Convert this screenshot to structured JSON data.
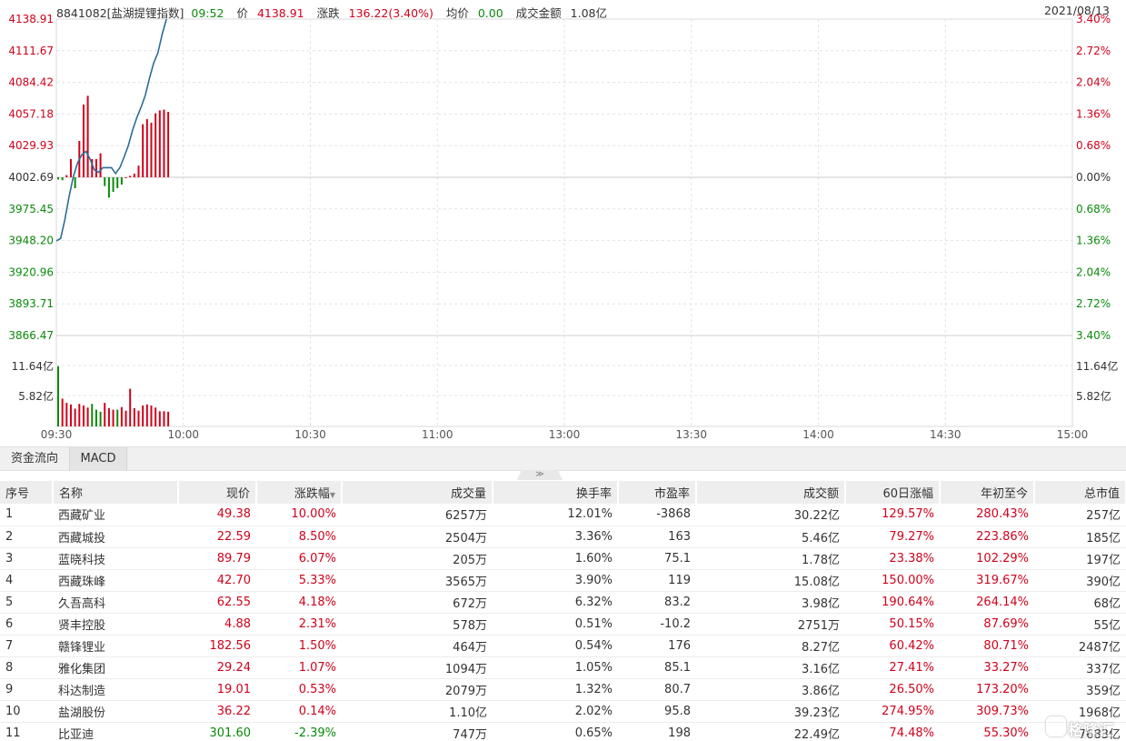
{
  "header": {
    "code_name": "8841082[盐湖提锂指数]",
    "time": "09:52",
    "price_label": "价",
    "price": "4138.91",
    "change_label": "涨跌",
    "change": "136.22(3.40%)",
    "avg_label": "均价",
    "avg": "0.00",
    "amount_label": "成交金额",
    "amount": "1.08亿",
    "date": "2021/08/13"
  },
  "colors": {
    "up": "#d0021b",
    "down": "#0b8a0b",
    "line": "#2b6d97"
  },
  "chart_data": {
    "type": "line",
    "price_ticks": [
      "4138.91",
      "4111.67",
      "4084.42",
      "4057.18",
      "4029.93",
      "4002.69",
      "3975.45",
      "3948.20",
      "3920.96",
      "3893.71",
      "3866.47"
    ],
    "percent_ticks": [
      "3.40%",
      "2.72%",
      "2.04%",
      "1.36%",
      "0.68%",
      "0.00%",
      "0.68%",
      "1.36%",
      "2.04%",
      "2.72%",
      "3.40%"
    ],
    "volume_ticks": [
      "11.64亿",
      "5.82亿"
    ],
    "time_ticks": [
      "09:30",
      "10:00",
      "10:30",
      "11:00",
      "13:00",
      "13:30",
      "14:00",
      "14:30",
      "15:00"
    ],
    "ylim": [
      3866.47,
      4138.91
    ],
    "prev_close": 4002.69,
    "minutes_total": 240,
    "price_minutes": [
      0,
      1,
      2,
      3,
      4,
      5,
      6,
      7,
      8,
      9,
      10,
      11,
      12,
      13,
      14,
      15,
      16,
      17,
      18,
      19,
      20,
      21,
      22,
      23,
      24,
      25,
      26
    ],
    "price_values": [
      3948,
      3950,
      3966,
      3986,
      4003,
      4015,
      4022,
      4025,
      4018,
      4009,
      4007,
      4011,
      4011,
      4011,
      4006,
      4011,
      4020,
      4030,
      4043,
      4054,
      4063,
      4073,
      4088,
      4101,
      4110,
      4126,
      4138.91
    ],
    "momentum_bars": [
      -3,
      -4,
      3,
      25,
      -15,
      50,
      100,
      112,
      25,
      25,
      33,
      -12,
      -28,
      -20,
      -15,
      -10,
      0,
      2,
      5,
      16,
      73,
      80,
      75,
      88,
      92,
      93,
      90
    ],
    "volume_bars": [
      [
        0,
        11.5
      ],
      [
        1,
        5.3
      ],
      [
        2,
        4.5
      ],
      [
        3,
        4.2
      ],
      [
        4,
        3.4
      ],
      [
        5,
        4.3
      ],
      [
        6,
        4.0
      ],
      [
        7,
        3.6
      ],
      [
        8,
        4.3
      ],
      [
        9,
        3.2
      ],
      [
        10,
        2.8
      ],
      [
        11,
        4.5
      ],
      [
        12,
        3.5
      ],
      [
        13,
        3.2
      ],
      [
        14,
        3.2
      ],
      [
        15,
        3.7
      ],
      [
        16,
        3.0
      ],
      [
        17,
        7.2
      ],
      [
        18,
        3.5
      ],
      [
        19,
        3.0
      ],
      [
        20,
        4.0
      ],
      [
        21,
        4.2
      ],
      [
        22,
        4.0
      ],
      [
        23,
        3.6
      ],
      [
        24,
        2.9
      ],
      [
        25,
        2.9
      ],
      [
        26,
        2.8
      ]
    ],
    "volume_max": 11.64
  },
  "tabs": [
    "资金流向",
    "MACD"
  ],
  "collapse_icon": "≫",
  "table": {
    "headers": [
      "序号",
      "名称",
      "现价",
      "涨跌幅",
      "成交量",
      "换手率",
      "市盈率",
      "成交额",
      "60日涨幅",
      "年初至今",
      "总市值"
    ],
    "sort_indicator": "▼",
    "rows": [
      [
        "1",
        "西藏矿业",
        "49.38",
        "10.00%",
        "6257万",
        "12.01%",
        "-3868",
        "30.22亿",
        "129.57%",
        "280.43%",
        "257亿"
      ],
      [
        "2",
        "西藏城投",
        "22.59",
        "8.50%",
        "2504万",
        "3.36%",
        "163",
        "5.46亿",
        "79.27%",
        "223.86%",
        "185亿"
      ],
      [
        "3",
        "蓝晓科技",
        "89.79",
        "6.07%",
        "205万",
        "1.60%",
        "75.1",
        "1.78亿",
        "23.38%",
        "102.29%",
        "197亿"
      ],
      [
        "4",
        "西藏珠峰",
        "42.70",
        "5.33%",
        "3565万",
        "3.90%",
        "119",
        "15.08亿",
        "150.00%",
        "319.67%",
        "390亿"
      ],
      [
        "5",
        "久吾高科",
        "62.55",
        "4.18%",
        "672万",
        "6.32%",
        "83.2",
        "3.98亿",
        "190.64%",
        "264.14%",
        "68亿"
      ],
      [
        "6",
        "贤丰控股",
        "4.88",
        "2.31%",
        "578万",
        "0.51%",
        "-10.2",
        "2751万",
        "50.15%",
        "87.69%",
        "55亿"
      ],
      [
        "7",
        "赣锋锂业",
        "182.56",
        "1.50%",
        "464万",
        "0.54%",
        "176",
        "8.27亿",
        "60.42%",
        "80.71%",
        "2487亿"
      ],
      [
        "8",
        "雅化集团",
        "29.24",
        "1.07%",
        "1094万",
        "1.05%",
        "85.1",
        "3.16亿",
        "27.41%",
        "33.27%",
        "337亿"
      ],
      [
        "9",
        "科达制造",
        "19.01",
        "0.53%",
        "2079万",
        "1.32%",
        "80.7",
        "3.86亿",
        "26.50%",
        "173.20%",
        "359亿"
      ],
      [
        "10",
        "盐湖股份",
        "36.22",
        "0.14%",
        "1.10亿",
        "2.02%",
        "95.8",
        "39.23亿",
        "274.95%",
        "309.73%",
        "1968亿"
      ],
      [
        "11",
        "比亚迪",
        "301.60",
        "-2.39%",
        "747万",
        "0.65%",
        "198",
        "22.49亿",
        "74.48%",
        "55.30%",
        "7683亿"
      ]
    ]
  },
  "logo_text": "格隆汇"
}
